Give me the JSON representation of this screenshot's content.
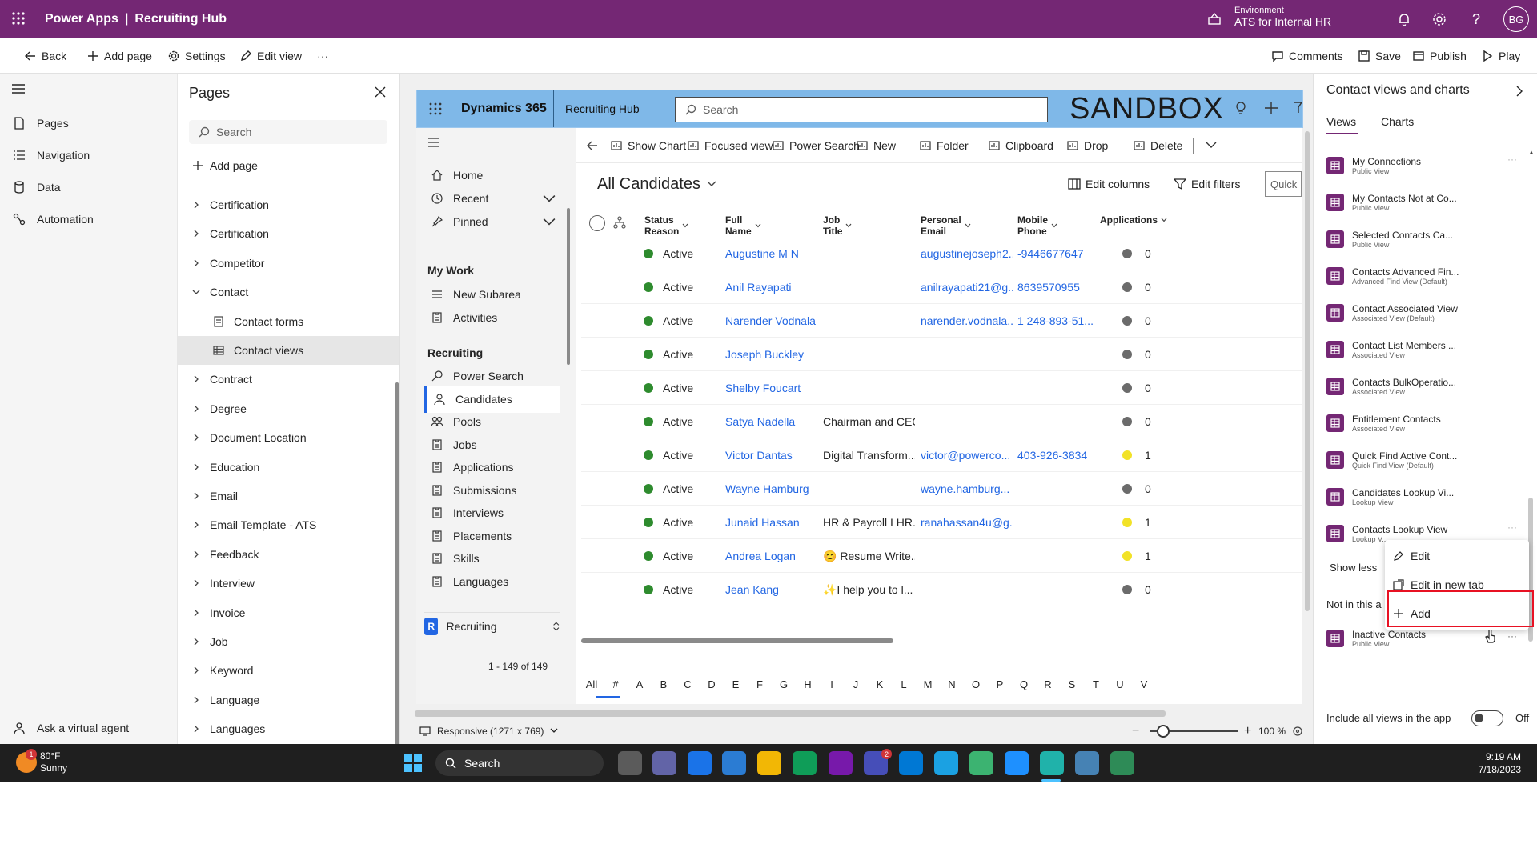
{
  "topbar": {
    "product": "Power Apps",
    "separator": "|",
    "app_name": "Recruiting Hub",
    "env_label": "Environment",
    "env_name": "ATS for Internal HR",
    "avatar_initials": "BG"
  },
  "commandbar": {
    "back": "Back",
    "add_page": "Add page",
    "settings": "Settings",
    "edit_view": "Edit view",
    "more": "···",
    "comments": "Comments",
    "save": "Save",
    "publish": "Publish",
    "play": "Play"
  },
  "leftrail": {
    "items": [
      "Pages",
      "Navigation",
      "Data",
      "Automation"
    ],
    "virtual_agent": "Ask a virtual agent"
  },
  "pages_panel": {
    "title": "Pages",
    "search_placeholder": "Search",
    "add_page": "Add page",
    "tree": [
      {
        "label": "Certification",
        "type": "collapsed"
      },
      {
        "label": "Certification",
        "type": "collapsed"
      },
      {
        "label": "Competitor",
        "type": "collapsed"
      },
      {
        "label": "Contact",
        "type": "expanded"
      },
      {
        "label": "Contact forms",
        "type": "sub-form"
      },
      {
        "label": "Contact views",
        "type": "sub-view"
      },
      {
        "label": "Contract",
        "type": "collapsed"
      },
      {
        "label": "Degree",
        "type": "collapsed"
      },
      {
        "label": "Document Location",
        "type": "collapsed"
      },
      {
        "label": "Education",
        "type": "collapsed"
      },
      {
        "label": "Email",
        "type": "collapsed"
      },
      {
        "label": "Email Template - ATS",
        "type": "collapsed"
      },
      {
        "label": "Feedback",
        "type": "collapsed"
      },
      {
        "label": "Interview",
        "type": "collapsed"
      },
      {
        "label": "Invoice",
        "type": "collapsed"
      },
      {
        "label": "Job",
        "type": "collapsed"
      },
      {
        "label": "Keyword",
        "type": "collapsed"
      },
      {
        "label": "Language",
        "type": "collapsed"
      },
      {
        "label": "Languages",
        "type": "collapsed"
      }
    ]
  },
  "d365": {
    "title": "Dynamics 365",
    "hub": "Recruiting Hub",
    "search_placeholder": "Search",
    "sandbox": "SANDBOX"
  },
  "sitemap": {
    "top": [
      "Home",
      "Recent",
      "Pinned"
    ],
    "my_work_head": "My Work",
    "my_work": [
      "New Subarea",
      "Activities"
    ],
    "recruiting_head": "Recruiting",
    "recruiting": [
      "Power Search",
      "Candidates",
      "Pools",
      "Jobs",
      "Applications",
      "Submissions",
      "Interviews",
      "Placements",
      "Skills",
      "Languages"
    ],
    "area_letter": "R",
    "area": "Recruiting"
  },
  "grid": {
    "cmds": [
      "Show Chart",
      "Focused view",
      "Power Search",
      "New",
      "Folder",
      "Clipboard",
      "Drop",
      "Delete"
    ],
    "view_title": "All Candidates",
    "edit_columns": "Edit columns",
    "edit_filters": "Edit filters",
    "quick_find": "Quick",
    "headers": [
      "Status Reason",
      "Full Name",
      "Job Title",
      "Personal Email",
      "Mobile Phone",
      "Applications"
    ],
    "rows": [
      {
        "status": "Active",
        "name": "Augustine M N",
        "job": "",
        "email": "augustinejoseph2...",
        "phone": "-9446677647",
        "app_dot": "#6b6b6b",
        "apps": "0"
      },
      {
        "status": "Active",
        "name": "Anil Rayapati",
        "job": "",
        "email": "anilrayapati21@g...",
        "phone": "8639570955",
        "app_dot": "#6b6b6b",
        "apps": "0"
      },
      {
        "status": "Active",
        "name": "Narender Vodnala",
        "job": "",
        "email": "narender.vodnala...",
        "phone": "1 248-893-51...",
        "app_dot": "#6b6b6b",
        "apps": "0"
      },
      {
        "status": "Active",
        "name": "Joseph Buckley",
        "job": "",
        "email": "",
        "phone": "",
        "app_dot": "#6b6b6b",
        "apps": "0"
      },
      {
        "status": "Active",
        "name": "Shelby Foucart",
        "job": "",
        "email": "",
        "phone": "",
        "app_dot": "#6b6b6b",
        "apps": "0"
      },
      {
        "status": "Active",
        "name": "Satya Nadella",
        "job": "Chairman and CEO",
        "email": "",
        "phone": "",
        "app_dot": "#6b6b6b",
        "apps": "0"
      },
      {
        "status": "Active",
        "name": "Victor Dantas",
        "job": "Digital Transform...",
        "email": "victor@powerco...",
        "phone": "403-926-3834",
        "app_dot": "#f2e227",
        "apps": "1"
      },
      {
        "status": "Active",
        "name": "Wayne Hamburg",
        "job": "",
        "email": "wayne.hamburg...",
        "phone": "",
        "app_dot": "#6b6b6b",
        "apps": "0"
      },
      {
        "status": "Active",
        "name": "Junaid Hassan",
        "job": "HR & Payroll I HR...",
        "email": "ranahassan4u@g...",
        "phone": "",
        "app_dot": "#f2e227",
        "apps": "1"
      },
      {
        "status": "Active",
        "name": "Andrea Logan",
        "job": "😊 Resume Write...",
        "email": "",
        "phone": "",
        "app_dot": "#f2e227",
        "apps": "1"
      },
      {
        "status": "Active",
        "name": "Jean Kang",
        "job": "✨I help you to l...",
        "email": "",
        "phone": "",
        "app_dot": "#6b6b6b",
        "apps": "0"
      }
    ],
    "alphabet": [
      "All",
      "#",
      "A",
      "B",
      "C",
      "D",
      "E",
      "F",
      "G",
      "H",
      "I",
      "J",
      "K",
      "L",
      "M",
      "N",
      "O",
      "P",
      "Q",
      "R",
      "S",
      "T",
      "U",
      "V"
    ],
    "record_count": "1 - 149 of 149"
  },
  "canvas_footer": {
    "responsive": "Responsive (1271 x 769)",
    "zoom": "100 %",
    "zoom_level": 0.15
  },
  "right_panel": {
    "title": "Contact views and charts",
    "tabs": [
      "Views",
      "Charts"
    ],
    "views": [
      {
        "name": "My Connections",
        "sub": "Public View"
      },
      {
        "name": "My Contacts Not at Co...",
        "sub": "Public View"
      },
      {
        "name": "Selected Contacts Ca...",
        "sub": "Public View"
      },
      {
        "name": "Contacts Advanced Fin...",
        "sub": "Advanced Find View (Default)"
      },
      {
        "name": "Contact Associated View",
        "sub": "Associated View (Default)"
      },
      {
        "name": "Contact List Members ...",
        "sub": "Associated View"
      },
      {
        "name": "Contacts BulkOperatio...",
        "sub": "Associated View"
      },
      {
        "name": "Entitlement Contacts",
        "sub": "Associated View"
      },
      {
        "name": "Quick Find Active Cont...",
        "sub": "Quick Find View (Default)"
      },
      {
        "name": "Candidates Lookup Vi...",
        "sub": "Lookup View"
      },
      {
        "name": "Contacts Lookup View",
        "sub": "Lookup V..."
      }
    ],
    "show_less": "Show less",
    "not_in_app": "Not in this a",
    "inactive_name": "Inactive Contacts",
    "inactive_sub": "Public View",
    "include_all": "Include all views in the app",
    "toggle_state": "Off"
  },
  "context_menu": {
    "items": [
      "Edit",
      "Edit in new tab",
      "Add"
    ],
    "highlight_color": "#e81123"
  },
  "taskbar": {
    "temp": "80°F",
    "weather": "Sunny",
    "weather_badge": "1",
    "search": "Search",
    "time": "9:19 AM",
    "date": "7/18/2023",
    "teams_badge": "2"
  },
  "colors": {
    "brand": "#742774",
    "link": "#2266e3",
    "active_dot": "#2e8b2e",
    "d365_bar": "#7fb8e8"
  }
}
